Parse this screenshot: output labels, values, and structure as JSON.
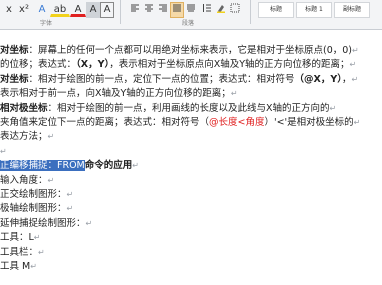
{
  "ribbon": {
    "font_buttons": [
      {
        "label": "x",
        "icon": "subscript-icon"
      },
      {
        "label": "x²",
        "icon": "superscript-icon"
      },
      {
        "label": "A",
        "icon": "text-effect-icon"
      },
      {
        "label": "ab",
        "icon": "highlight-icon"
      },
      {
        "label": "A",
        "icon": "font-color-icon"
      },
      {
        "label": "A",
        "icon": "char-shading-icon"
      },
      {
        "label": "A",
        "icon": "char-border-icon"
      }
    ],
    "group_font_label": "字体",
    "group_paragraph_label": "段落",
    "styles": [
      "标题",
      "标题 1",
      "副标题"
    ],
    "colors": {
      "highlight": "#f2d21b",
      "font_color": "#e02020",
      "active": "#f5d9a8"
    }
  },
  "document": {
    "lines": [
      {
        "segments": [
          {
            "t": "对坐标",
            "s": "b"
          },
          {
            "t": "：屏幕上的任何一个点都可以用绝对坐标来表示，它是相对于坐标原点(0，0)",
            "s": ""
          }
        ]
      },
      {
        "segments": [
          {
            "t": "的位移；表达式：",
            "s": ""
          },
          {
            "t": "（X，Y）",
            "s": "b"
          },
          {
            "t": "，表示相对于坐标原点向X轴及Y轴的正方向位移的距离；",
            "s": ""
          }
        ]
      },
      {
        "segments": [
          {
            "t": "对坐标",
            "s": "b"
          },
          {
            "t": "：相对于绘图的前一点，定位下一点的位置；表达式：相对符号",
            "s": ""
          },
          {
            "t": "（@X，Y）",
            "s": "b"
          },
          {
            "t": "，",
            "s": ""
          }
        ]
      },
      {
        "segments": [
          {
            "t": "表示相对于前一点，向X轴及Y轴的正方向位移的距离；",
            "s": ""
          }
        ]
      },
      {
        "segments": [
          {
            "t": "相对极坐标",
            "s": "b"
          },
          {
            "t": "：相对于绘图的前一点，利用画线的长度以及此线与X轴的正方向的",
            "s": ""
          }
        ]
      },
      {
        "segments": [
          {
            "t": "夹角值来定位下一点的距离；表达式：相对符号（",
            "s": ""
          },
          {
            "t": "@长度<角度",
            "s": "red"
          },
          {
            "t": "）'<'是相对极坐标的",
            "s": ""
          }
        ]
      },
      {
        "segments": [
          {
            "t": "表达方法；",
            "s": ""
          }
        ]
      },
      {
        "segments": [
          {
            "t": "",
            "s": ""
          }
        ]
      },
      {
        "segments": [
          {
            "t": "正编移捕捉：FROM",
            "s": "sel"
          },
          {
            "t": "命令的应用",
            "s": "b"
          }
        ]
      },
      {
        "segments": [
          {
            "t": "输入角度：",
            "s": ""
          }
        ]
      },
      {
        "segments": [
          {
            "t": "正交绘制图形：",
            "s": ""
          }
        ]
      },
      {
        "segments": [
          {
            "t": "极轴绘制图形：",
            "s": ""
          }
        ]
      },
      {
        "segments": [
          {
            "t": "延伸捕捉绘制图形：",
            "s": ""
          }
        ]
      },
      {
        "segments": [
          {
            "t": "工具：L",
            "s": ""
          }
        ]
      },
      {
        "segments": [
          {
            "t": "工具栏：",
            "s": ""
          }
        ]
      },
      {
        "segments": [
          {
            "t": "工具 M",
            "s": ""
          }
        ]
      }
    ]
  }
}
